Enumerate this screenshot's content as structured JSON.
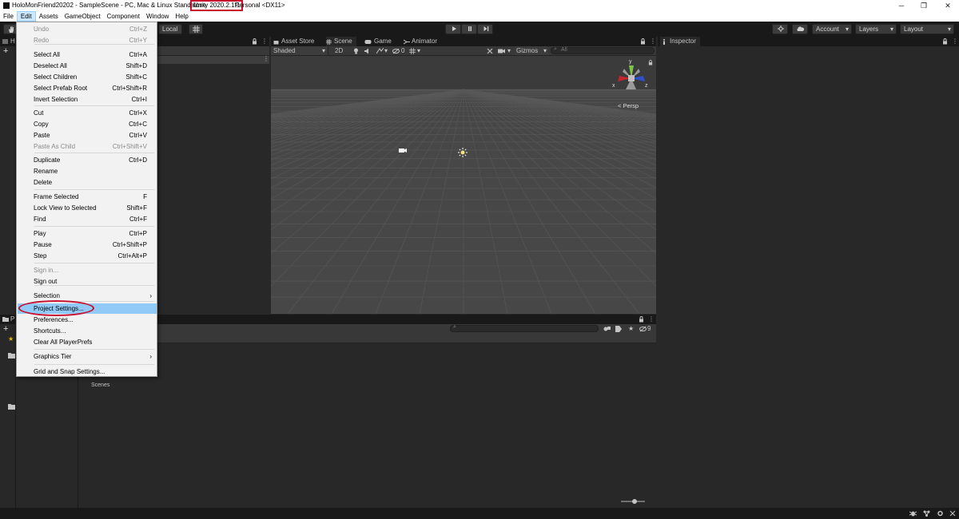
{
  "window": {
    "title_prefix": "HoloMonFriend20202 - SampleScene - PC, Mac & Linux Standalone ",
    "title_version": "Unity 2020.2.1f1",
    "title_suffix": " Personal <DX11>",
    "min_glyph": "─",
    "max_glyph": "❐",
    "close_glyph": "✕"
  },
  "menubar": [
    "File",
    "Edit",
    "Assets",
    "GameObject",
    "Component",
    "Window",
    "Help"
  ],
  "toolbar": {
    "pivot_label": "Local",
    "account_label": "Account",
    "layers_label": "Layers",
    "layout_label": "Layout"
  },
  "scene": {
    "tabs": [
      "Asset Store",
      "Scene",
      "Game",
      "Animator"
    ],
    "shading": "Shaded",
    "mode_2d": "2D",
    "fx_count": "0",
    "gizmos_label": "Gizmos",
    "search_placeholder": "All",
    "persp_label": "< Persp",
    "axis_x": "x",
    "axis_y": "y",
    "axis_z": "z"
  },
  "inspector": {
    "tab_label": "Inspector"
  },
  "project": {
    "folder_label": "Scenes",
    "hidden_count": "9"
  },
  "left_panel": {
    "hier_tab_initial": "H",
    "project_tab_initial": "P"
  },
  "edit_menu": {
    "items": [
      {
        "label": "Undo",
        "shortcut": "Ctrl+Z",
        "disabled": true
      },
      {
        "label": "Redo",
        "shortcut": "Ctrl+Y",
        "disabled": true
      },
      {
        "label": "Select All",
        "shortcut": "Ctrl+A"
      },
      {
        "label": "Deselect All",
        "shortcut": "Shift+D"
      },
      {
        "label": "Select Children",
        "shortcut": "Shift+C"
      },
      {
        "label": "Select Prefab Root",
        "shortcut": "Ctrl+Shift+R"
      },
      {
        "label": "Invert Selection",
        "shortcut": "Ctrl+I"
      },
      {
        "label": "Cut",
        "shortcut": "Ctrl+X"
      },
      {
        "label": "Copy",
        "shortcut": "Ctrl+C"
      },
      {
        "label": "Paste",
        "shortcut": "Ctrl+V"
      },
      {
        "label": "Paste As Child",
        "shortcut": "Ctrl+Shift+V",
        "disabled": true
      },
      {
        "label": "Duplicate",
        "shortcut": "Ctrl+D"
      },
      {
        "label": "Rename",
        "shortcut": ""
      },
      {
        "label": "Delete",
        "shortcut": ""
      },
      {
        "label": "Frame Selected",
        "shortcut": "F"
      },
      {
        "label": "Lock View to Selected",
        "shortcut": "Shift+F"
      },
      {
        "label": "Find",
        "shortcut": "Ctrl+F"
      },
      {
        "label": "Play",
        "shortcut": "Ctrl+P"
      },
      {
        "label": "Pause",
        "shortcut": "Ctrl+Shift+P"
      },
      {
        "label": "Step",
        "shortcut": "Ctrl+Alt+P"
      },
      {
        "label": "Sign in...",
        "shortcut": "",
        "disabled": true
      },
      {
        "label": "Sign out",
        "shortcut": ""
      },
      {
        "label": "Selection",
        "shortcut": "",
        "submenu": true
      },
      {
        "label": "Project Settings...",
        "shortcut": "",
        "highlighted": true
      },
      {
        "label": "Preferences...",
        "shortcut": ""
      },
      {
        "label": "Shortcuts...",
        "shortcut": ""
      },
      {
        "label": "Clear All PlayerPrefs",
        "shortcut": ""
      },
      {
        "label": "Graphics Tier",
        "shortcut": "",
        "submenu": true
      },
      {
        "label": "Grid and Snap Settings...",
        "shortcut": ""
      }
    ],
    "submenu_arrow": "›"
  },
  "colors": {
    "annotation_red": "#c8102e",
    "menu_highlight": "#91c9f7",
    "editor_dark": "#282828",
    "scene_gray": "#444444"
  }
}
